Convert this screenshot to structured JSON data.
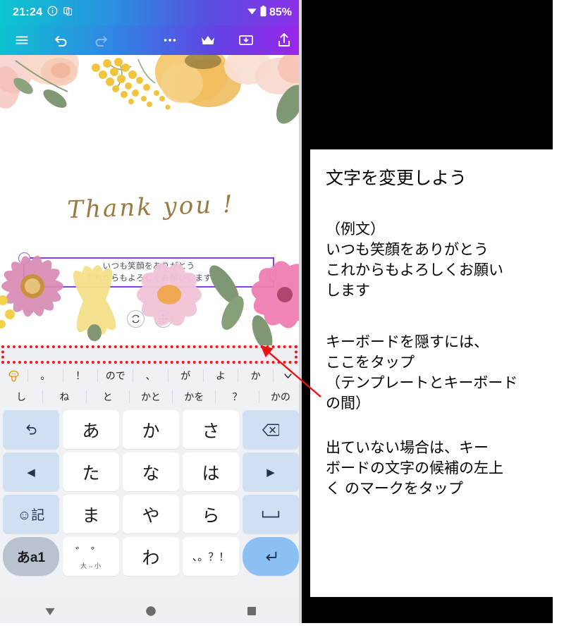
{
  "phone": {
    "status_bar": {
      "time": "21:24",
      "info_icon": "info-circle-icon",
      "secondary_icon": "app-badge-icon",
      "wifi_icon": "wifi-icon",
      "battery_icon": "battery-icon",
      "battery_text": "85%"
    },
    "toolbar": {
      "menu_icon": "hamburger-menu-icon",
      "undo_icon": "undo-icon",
      "redo_icon": "redo-icon",
      "more_icon": "more-horizontal-icon",
      "crown_icon": "crown-premium-icon",
      "save_icon": "save-to-device-icon",
      "share_icon": "share-upload-icon"
    },
    "canvas": {
      "headline": "Thank you !",
      "textbox": {
        "line1": "いつも笑顔をありがとう",
        "line2": "これからもよろしくお願いします",
        "border_color": "#8b3ce8",
        "corner_handle": "resize-handle",
        "side_handle": "resize-handle-side"
      },
      "object_tools": [
        {
          "name": "rotate-icon",
          "glyph": "⟳"
        },
        {
          "name": "move-icon",
          "glyph": "✥"
        }
      ]
    },
    "gap_strip": {
      "highlight_color": "#ef1a1a",
      "note": "template-keyboard-gap"
    },
    "keyboard": {
      "suggestion_row_1": [
        {
          "label": "",
          "icon": "mushroom-assistant-icon"
        },
        {
          "label": "。"
        },
        {
          "label": "！"
        },
        {
          "label": "ので"
        },
        {
          "label": "、"
        },
        {
          "label": "が"
        },
        {
          "label": "よ"
        },
        {
          "label": "か"
        },
        {
          "label": "",
          "icon": "chevron-down-icon"
        }
      ],
      "suggestion_row_2": [
        {
          "label": "し"
        },
        {
          "label": "ね"
        },
        {
          "label": "と"
        },
        {
          "label": "かと"
        },
        {
          "label": "かを"
        },
        {
          "label": "？"
        },
        {
          "label": "かの"
        }
      ],
      "rows": [
        [
          {
            "label": "↰",
            "name": "key-undo",
            "type": "fn"
          },
          {
            "label": "あ",
            "name": "key-a",
            "type": "char"
          },
          {
            "label": "か",
            "name": "key-ka",
            "type": "char"
          },
          {
            "label": "さ",
            "name": "key-sa",
            "type": "char"
          },
          {
            "label": "⌫",
            "name": "key-backspace",
            "type": "fn"
          }
        ],
        [
          {
            "label": "◀",
            "name": "key-cursor-left",
            "type": "fn"
          },
          {
            "label": "た",
            "name": "key-ta",
            "type": "char"
          },
          {
            "label": "な",
            "name": "key-na",
            "type": "char"
          },
          {
            "label": "は",
            "name": "key-ha",
            "type": "char"
          },
          {
            "label": "▶",
            "name": "key-cursor-right",
            "type": "fn"
          }
        ],
        [
          {
            "label": "☺記",
            "name": "key-emoji-symbols",
            "type": "fn"
          },
          {
            "label": "ま",
            "name": "key-ma",
            "type": "char"
          },
          {
            "label": "や",
            "name": "key-ya",
            "type": "char"
          },
          {
            "label": "ら",
            "name": "key-ra",
            "type": "char"
          },
          {
            "label": "␣",
            "name": "key-space",
            "type": "fn"
          }
        ],
        [
          {
            "label": "あa1",
            "name": "key-input-mode",
            "type": "mode"
          },
          {
            "label": "゛゜",
            "sub": "大⇔小",
            "name": "key-dakuten-case",
            "type": "char-sub"
          },
          {
            "label": "わ",
            "name": "key-wa",
            "type": "char"
          },
          {
            "label": "、。？！",
            "name": "key-punctuation",
            "type": "char-small"
          },
          {
            "label": "↵",
            "name": "key-enter",
            "type": "enter"
          }
        ]
      ]
    },
    "nav_bar": [
      {
        "name": "nav-back-button",
        "icon": "triangle-down-icon"
      },
      {
        "name": "nav-home-button",
        "icon": "circle-icon"
      },
      {
        "name": "nav-recents-button",
        "icon": "square-icon"
      }
    ]
  },
  "panel": {
    "title": "文字を変更しよう",
    "example_label": "（例文）",
    "example_line1": "いつも笑顔をありがとう",
    "example_line2": "これからもよろしくお願い",
    "example_line3": "します",
    "hide_line1": "キーボードを隠すには、",
    "hide_line2": "ここをタップ",
    "hide_line3": "（テンプレートとキーボード",
    "hide_line4": "の間）",
    "show_line1": "出ていない場合は、キー",
    "show_line2": "ボードの文字の候補の左上",
    "show_line3": "く のマークをタップ",
    "arrow_color": "#ee1111"
  }
}
